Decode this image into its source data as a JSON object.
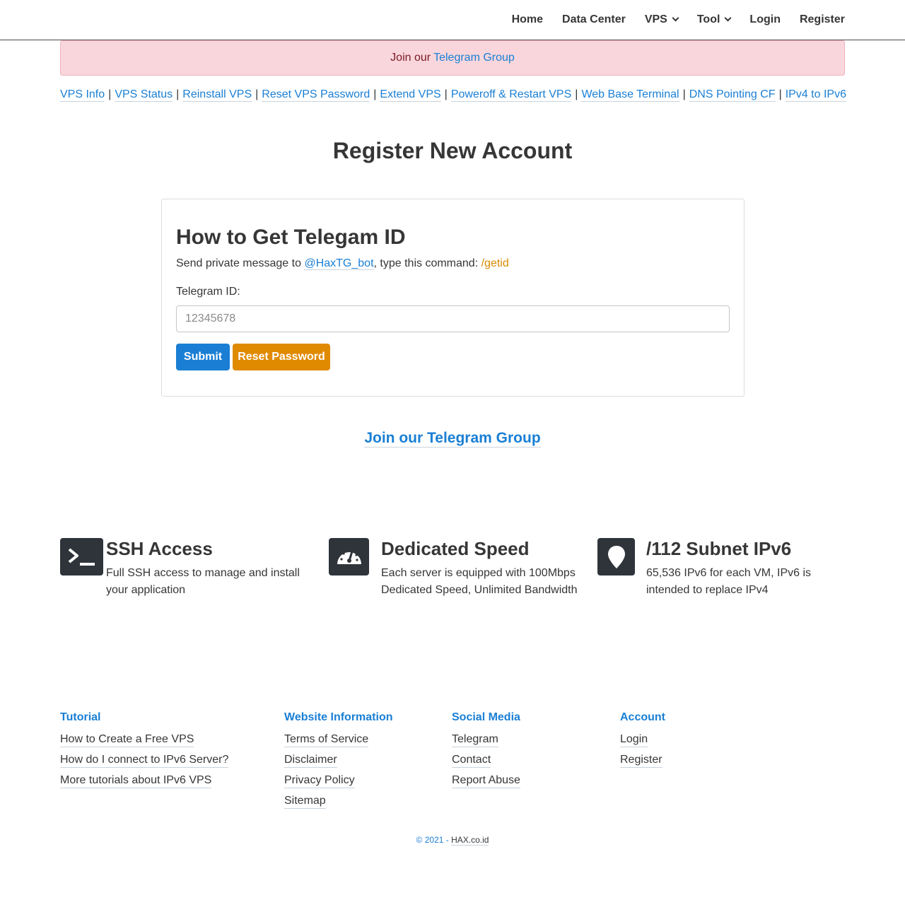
{
  "nav": {
    "home": "Home",
    "data_center": "Data Center",
    "vps": "VPS",
    "tool": "Tool",
    "login": "Login",
    "register": "Register"
  },
  "alert": {
    "text": "Join our",
    "link": "Telegram Group"
  },
  "quick_links": [
    "VPS Info",
    "VPS Status",
    "Reinstall VPS",
    "Reset VPS Password",
    "Extend VPS",
    "Poweroff & Restart VPS",
    "Web Base Terminal",
    "DNS Pointing CF",
    "IPv4 to IPv6"
  ],
  "quick_sep": "|",
  "page_title": "Register New Account",
  "card": {
    "heading": "How to Get Telegam ID",
    "note_prefix": "Send private message to",
    "bot": "@HaxTG_bot",
    "note_mid": ", type this command:",
    "command": "/getid",
    "label": "Telegram ID:",
    "placeholder": "12345678",
    "submit": "Submit",
    "reset": "Reset Password"
  },
  "join_big": "Join our Telegram Group",
  "features": [
    {
      "title": "SSH Access",
      "desc": "Full SSH access to manage and install your application"
    },
    {
      "title": "Dedicated Speed",
      "desc": "Each server is equipped with 100Mbps Dedicated Speed, Unlimited Bandwidth"
    },
    {
      "title": "/112 Subnet IPv6",
      "desc": "65,536 IPv6 for each VM, IPv6 is intended to replace IPv4"
    }
  ],
  "footer": {
    "tutorial": {
      "heading": "Tutorial",
      "links": [
        "How to Create a Free VPS",
        "How do I connect to IPv6 Server?",
        "More tutorials about IPv6 VPS"
      ]
    },
    "website": {
      "heading": "Website Information",
      "links": [
        "Terms of Service",
        "Disclaimer",
        "Privacy Policy",
        "Sitemap"
      ]
    },
    "social": {
      "heading": "Social Media",
      "links": [
        "Telegram",
        "Contact",
        "Report Abuse"
      ]
    },
    "account": {
      "heading": "Account",
      "links": [
        "Login",
        "Register"
      ]
    }
  },
  "copyright": {
    "text": "© 2021 -",
    "site": "HAX.co.id"
  },
  "colors": {
    "link": "#1a7fd4",
    "submit": "#1a7fd4",
    "reset": "#e08a00",
    "alert_bg": "#f9d6dc",
    "icon_bg": "#2f343b",
    "command": "#d98a00"
  }
}
